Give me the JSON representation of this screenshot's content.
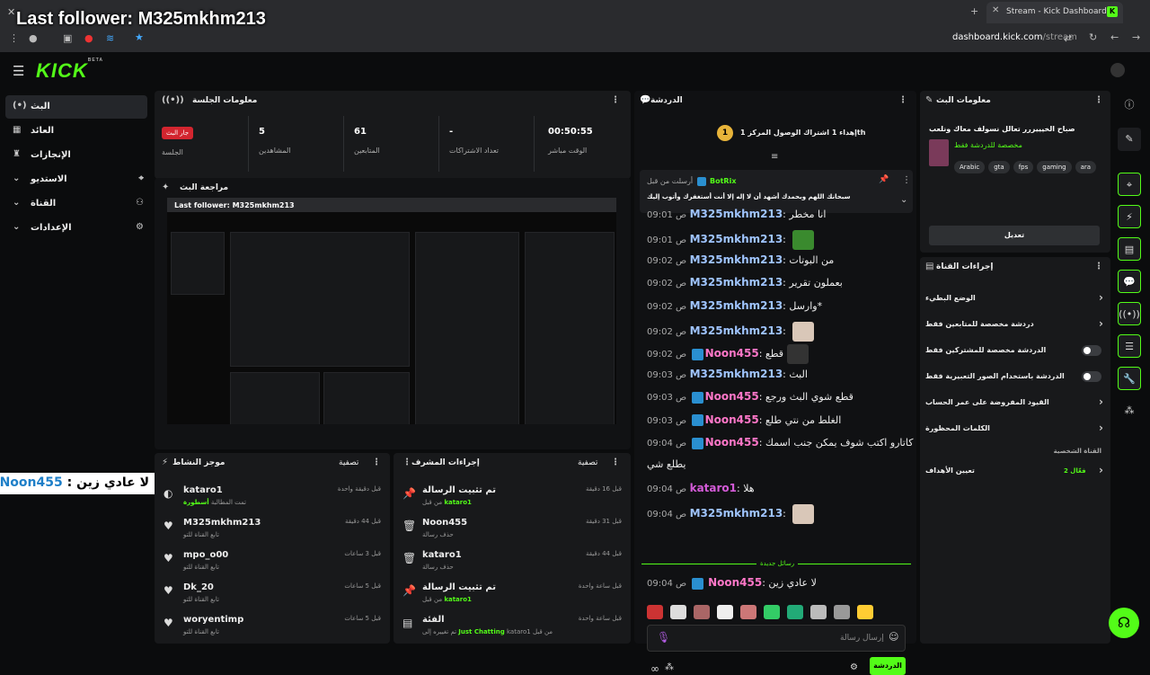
{
  "overlay": {
    "title": "Last follower: M325mkhm213",
    "chat_user": "Noon455",
    "chat_text": "لا عادي زين :"
  },
  "browser": {
    "tab_title": "Stream - Kick Dashboard",
    "url_host": "dashboard.kick.com",
    "url_path": "/stream"
  },
  "app": {
    "logo": "KICK",
    "logo_sup": "BETA"
  },
  "sidebar": {
    "items": [
      {
        "label": "البث",
        "icon": "broadcast-icon"
      },
      {
        "label": "العائد",
        "icon": "revenue-icon"
      },
      {
        "label": "الإنجازات",
        "icon": "trophy-icon"
      },
      {
        "label": "الاستديو",
        "icon": "studio-icon"
      },
      {
        "label": "القناة",
        "icon": "channel-icon"
      },
      {
        "label": "الإعدادات",
        "icon": "settings-icon"
      }
    ]
  },
  "session": {
    "title": "معلومات الجلسة",
    "live_badge": "جار البث",
    "session_label": "الجلسة",
    "viewers_value": "5",
    "viewers_label": "المشاهدين",
    "followers_value": "61",
    "followers_label": "المتابعين",
    "subs_value": "-",
    "subs_label": "تعداد الاشتراكات",
    "uptime_value": "00:50:55",
    "uptime_label": "الوقت مباشر"
  },
  "preview": {
    "title": "مراجعة البث",
    "inner_title": "Last follower: M325mkhm213"
  },
  "chat": {
    "title": "الدردشة",
    "gift_banner": "إهداء 1 اشتراك الوصول المركز 1th",
    "pinned_sender_prefix": "أرسلت من قبل",
    "pinned_sender": "BotRix",
    "pinned_text": "سبحانك اللهم وبحمدك أشهد أن لا إله إلا أنت أستغفرك وأتوب إليك",
    "messages": [
      {
        "time": "09:01 ص",
        "user": "M325mkhm213",
        "text": "انا مخطر",
        "color": "#9fc4ff",
        "badge": false,
        "emote": ""
      },
      {
        "time": "09:01 ص",
        "user": "M325mkhm213",
        "text": "",
        "color": "#9fc4ff",
        "badge": false,
        "emote": "#3a8a2e"
      },
      {
        "time": "09:02 ص",
        "user": "M325mkhm213",
        "text": "من البوتات",
        "color": "#9fc4ff",
        "badge": false,
        "emote": ""
      },
      {
        "time": "09:02 ص",
        "user": "M325mkhm213",
        "text": "بعملون تقرير",
        "color": "#9fc4ff",
        "badge": false,
        "emote": ""
      },
      {
        "time": "09:02 ص",
        "user": "M325mkhm213",
        "text": "وارسل*",
        "color": "#9fc4ff",
        "badge": false,
        "emote": ""
      },
      {
        "time": "09:02 ص",
        "user": "M325mkhm213",
        "text": "",
        "color": "#9fc4ff",
        "badge": false,
        "emote": "#d9c7b8"
      },
      {
        "time": "09:02 ص",
        "user": "Noon455",
        "text": "قطع",
        "color": "#ff77c8",
        "badge": true,
        "emote": "#333"
      },
      {
        "time": "09:03 ص",
        "user": "M325mkhm213",
        "text": "البث",
        "color": "#9fc4ff",
        "badge": false,
        "emote": ""
      },
      {
        "time": "09:03 ص",
        "user": "Noon455",
        "text": "قطع شوي البث ورجع",
        "color": "#ff77c8",
        "badge": true,
        "emote": ""
      },
      {
        "time": "09:03 ص",
        "user": "Noon455",
        "text": "الغلط من نتي طلع",
        "color": "#ff77c8",
        "badge": true,
        "emote": ""
      },
      {
        "time": "09:04 ص",
        "user": "Noon455",
        "text": "كاتارو اكتب شوف يمكن جنب اسمك",
        "color": "#ff77c8",
        "badge": true,
        "emote": ""
      },
      {
        "time": "",
        "user": "",
        "text": "يطلع شي",
        "color": "#eee",
        "badge": false,
        "emote": ""
      },
      {
        "time": "09:04 ص",
        "user": "kataro1",
        "text": "هلا",
        "color": "#d45bd8",
        "badge": false,
        "emote": ""
      },
      {
        "time": "09:04 ص",
        "user": "M325mkhm213",
        "text": "",
        "color": "#9fc4ff",
        "badge": false,
        "emote": "#d9c7b8"
      }
    ],
    "new_messages_label": "رسائل جديدة",
    "last_message": {
      "time": "09:04 ص",
      "user": "Noon455",
      "text": "لا عادي زين"
    },
    "input_placeholder": "إرسال رسالة",
    "send_label": "الدردشة"
  },
  "stream_info": {
    "title": "معلومات البث",
    "stream_title": "صباح الخيييررر تعالل نسولف معاك ونلعب",
    "subtitle": "مخصصة للدردشة فقط",
    "tags": [
      "Arabic",
      "gta",
      "fps",
      "gaming",
      "ara"
    ],
    "edit_label": "تعديل"
  },
  "channel_actions": {
    "title": "إجراءات القناة",
    "items": [
      {
        "label": "الوضع البطيء",
        "type": "chevron"
      },
      {
        "label": "دردشة مخصصة للمتابعين فقط",
        "type": "chevron"
      },
      {
        "label": "الدردشة مخصصة للمشتركين فقط",
        "type": "toggle"
      },
      {
        "label": "الدردشة باستخدام الصور التعبيرية فقط",
        "type": "toggle"
      },
      {
        "label": "القيود المفروضة على عمر الحساب",
        "type": "chevron"
      },
      {
        "label": "الكلمات المحظورة",
        "type": "chevron"
      }
    ],
    "goals_header": "القناة الشخصية",
    "goals_label": "تعيين الأهداف",
    "goals_count": "فعّال 2"
  },
  "activity": {
    "title": "موجز النشاط",
    "filter_label": "تصفية",
    "rows": [
      {
        "name": "kataro1",
        "sub_prefix": "تمت المطالبة",
        "sub_highlight": "أسطورة",
        "time": "قبل دقيقة واحدة",
        "icon": "user-icon"
      },
      {
        "name": "M325mkhm213",
        "sub_prefix": "تابع القناة للتو",
        "sub_highlight": "",
        "time": "قبل 44 دقيقة",
        "icon": "heart-icon"
      },
      {
        "name": "mpo_o00",
        "sub_prefix": "تابع القناة للتو",
        "sub_highlight": "",
        "time": "قبل 3 ساعات",
        "icon": "heart-icon"
      },
      {
        "name": "Dk_20",
        "sub_prefix": "تابع القناة للتو",
        "sub_highlight": "",
        "time": "قبل 5 ساعات",
        "icon": "heart-icon"
      },
      {
        "name": "woryentimp",
        "sub_prefix": "تابع القناة للتو",
        "sub_highlight": "",
        "time": "قبل 5 ساعات",
        "icon": "heart-icon"
      }
    ]
  },
  "mod_actions": {
    "title": "إجراءات المشرف",
    "filter_label": "تصفية",
    "rows": [
      {
        "name": "تم تثبيت الرسالة",
        "sub_prefix": "من قبل",
        "sub_highlight": "kataro1",
        "time": "قبل 16 دقيقة",
        "icon": "pin-icon"
      },
      {
        "name": "Noon455",
        "sub_prefix": "حذف رسالة",
        "sub_highlight": "",
        "time": "قبل 31 دقيقة",
        "icon": "trash-icon"
      },
      {
        "name": "kataro1",
        "sub_prefix": "حذف رسالة",
        "sub_highlight": "",
        "time": "قبل 44 دقيقة",
        "icon": "trash-icon"
      },
      {
        "name": "تم تثبيت الرسالة",
        "sub_prefix": "من قبل",
        "sub_highlight": "kataro1",
        "time": "قبل ساعة واحدة",
        "icon": "pin-icon"
      },
      {
        "name": "الفئة",
        "sub_prefix": "تم تغييره إلى",
        "sub_highlight": "Just Chatting",
        "sub_suffix": "kataro1 من قبل",
        "time": "قبل ساعة واحدة",
        "icon": "category-icon"
      }
    ]
  },
  "colors": {
    "brand": "#53fc18",
    "live": "#d3252f",
    "panel": "#18191b"
  }
}
